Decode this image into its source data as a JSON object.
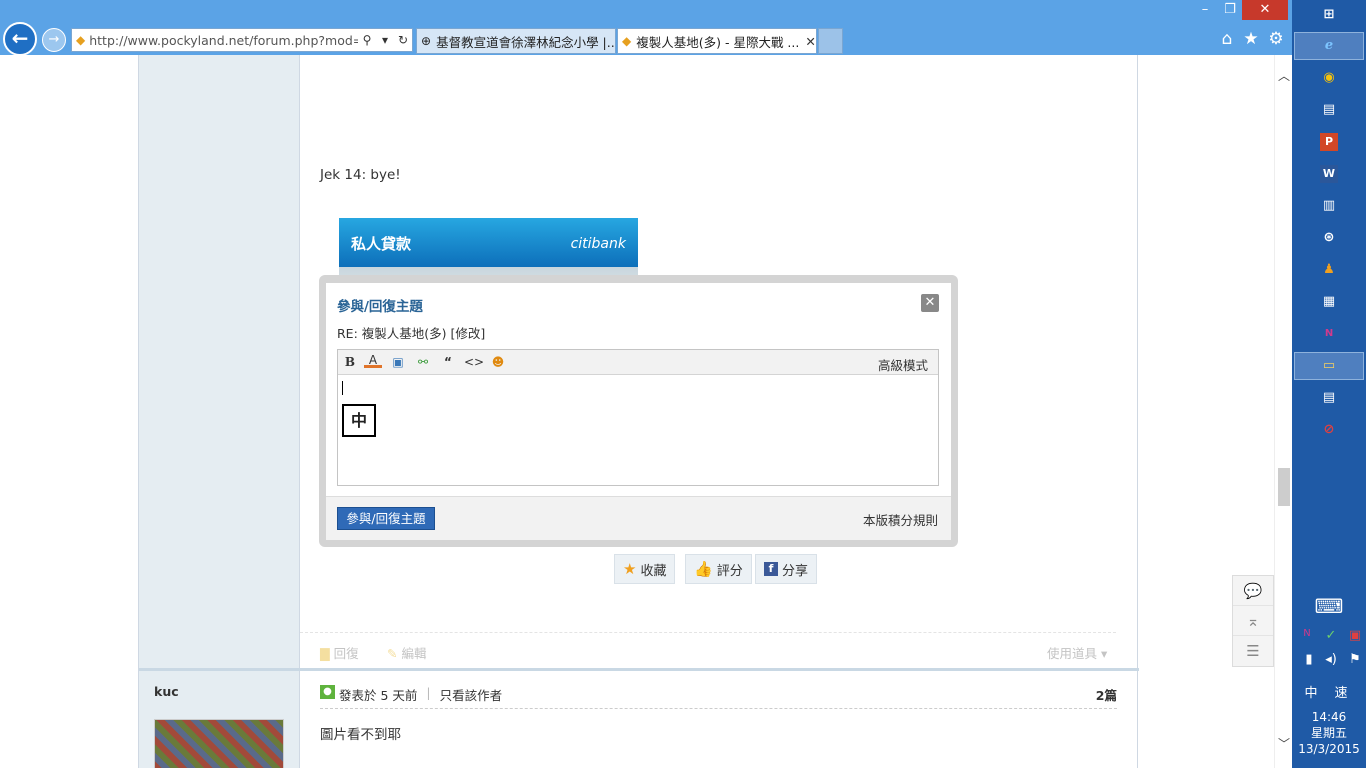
{
  "browser": {
    "url": "http://www.pockyland.net/forum.php?mod=vi",
    "tabs": [
      {
        "title": "基督教宣道會徐澤林紀念小學 |..."
      },
      {
        "title": "複製人基地(多) - 星際大戰 ..."
      }
    ],
    "close_tab_glyph": "✕",
    "window_controls": {
      "minimize": "–",
      "restore": "❐",
      "close": "✕"
    }
  },
  "post": {
    "text": "Jek 14: bye!",
    "ad": {
      "title": "私人貸款",
      "brand": "citibank"
    }
  },
  "reply_dialog": {
    "title": "參與/回復主題",
    "subtitle": "RE: 複製人基地(多) [修改]",
    "toolbar": {
      "bold": "B",
      "font_color": "A",
      "quote": "“",
      "code": "<>",
      "advanced": "高級模式"
    },
    "ime_char": "中",
    "submit_label": "參與/回復主題",
    "rules_link": "本版積分規則"
  },
  "post_buttons": {
    "favorite": "收藏",
    "rate": "評分",
    "share": "分享"
  },
  "post_actions": {
    "reply": "回復",
    "edit": "編輯",
    "tools": "使用道具"
  },
  "second_post": {
    "author": "kuc",
    "posted": "發表於 5 天前",
    "only_author": "只看該作者",
    "floor": "2篇",
    "body": "圖片看不到耶"
  },
  "system_tray": {
    "ime_mode": "中",
    "ime_speed": "速",
    "time": "14:46",
    "weekday": "星期五",
    "date": "13/3/2015"
  },
  "colors": {
    "chrome": "#5ba3e6",
    "taskbar": "#1f5aa6",
    "accent": "#2f6ab7"
  }
}
